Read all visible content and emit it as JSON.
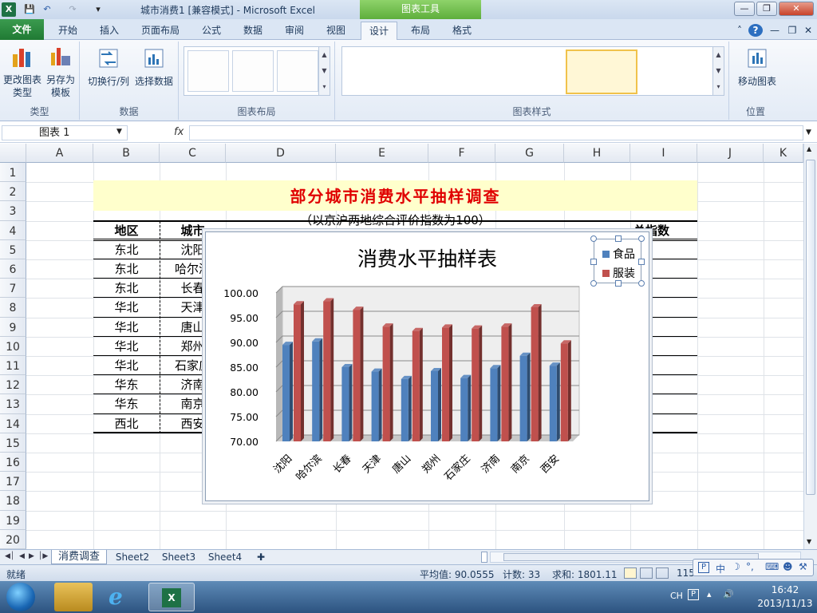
{
  "window": {
    "title": "城市消费1  [兼容模式] - Microsoft Excel",
    "contextual_tab": "图表工具"
  },
  "tabs": [
    "文件",
    "开始",
    "插入",
    "页面布局",
    "公式",
    "数据",
    "审阅",
    "视图",
    "设计",
    "布局",
    "格式"
  ],
  "ribbon": {
    "type_group": {
      "label": "类型",
      "change_type": "更改图表类型",
      "save_template": "另存为模板"
    },
    "data_group": {
      "label": "数据",
      "switch": "切换行/列",
      "select": "选择数据"
    },
    "layout_group": {
      "label": "图表布局"
    },
    "style_group": {
      "label": "图表样式"
    },
    "location_group": {
      "label": "位置",
      "move": "移动图表"
    }
  },
  "formula_bar": {
    "name_box": "图表  1",
    "fx": "fx"
  },
  "columns": [
    "A",
    "B",
    "C",
    "D",
    "E",
    "F",
    "G",
    "H",
    "I",
    "J",
    "K"
  ],
  "rows": [
    "1",
    "2",
    "3",
    "4",
    "5",
    "6",
    "7",
    "8",
    "9",
    "10",
    "11",
    "12",
    "13",
    "14",
    "15",
    "16",
    "17",
    "18",
    "19",
    "20"
  ],
  "sheet": {
    "title": "部分城市消费水平抽样调查",
    "subtitle": "（以京沪两地综合评价指数为100）",
    "header": {
      "region": "地区",
      "city": "城市",
      "total": "总指数"
    },
    "table": [
      {
        "region": "东北",
        "city": "沈阳"
      },
      {
        "region": "东北",
        "city": "哈尔滨"
      },
      {
        "region": "东北",
        "city": "长春"
      },
      {
        "region": "华北",
        "city": "天津"
      },
      {
        "region": "华北",
        "city": "唐山"
      },
      {
        "region": "华北",
        "city": "郑州"
      },
      {
        "region": "华北",
        "city": "石家庄"
      },
      {
        "region": "华东",
        "city": "济南"
      },
      {
        "region": "华东",
        "city": "南京"
      },
      {
        "region": "西北",
        "city": "西安"
      }
    ]
  },
  "chart_data": {
    "type": "bar",
    "title": "消费水平抽样表",
    "categories": [
      "沈阳",
      "哈尔滨",
      "长春",
      "天津",
      "唐山",
      "郑州",
      "石家庄",
      "济南",
      "南京",
      "西安"
    ],
    "series": [
      {
        "name": "食品",
        "color": "#4f81bd",
        "values": [
          89.5,
          90.2,
          85.0,
          84.1,
          82.6,
          84.2,
          82.8,
          84.8,
          87.3,
          85.3
        ]
      },
      {
        "name": "服装",
        "color": "#c0504d",
        "values": [
          97.7,
          98.3,
          96.6,
          93.2,
          92.3,
          93.0,
          92.8,
          93.2,
          97.1,
          89.8
        ]
      }
    ],
    "ylim": [
      70,
      100
    ],
    "yticks": [
      "100.00",
      "95.00",
      "90.00",
      "85.00",
      "80.00",
      "75.00",
      "70.00"
    ],
    "legend_position": "top-right",
    "grid": true
  },
  "sheet_tabs": [
    "消费调查",
    "Sheet2",
    "Sheet3",
    "Sheet4"
  ],
  "status": {
    "mode": "就绪",
    "average": "平均值: 90.0555",
    "count": "计数: 33",
    "sum": "求和: 1801.11",
    "zoom": "115"
  },
  "ime": {
    "lang": "中"
  },
  "taskbar": {
    "lang": "CH",
    "time": "16:42",
    "date": "2013/11/13"
  }
}
